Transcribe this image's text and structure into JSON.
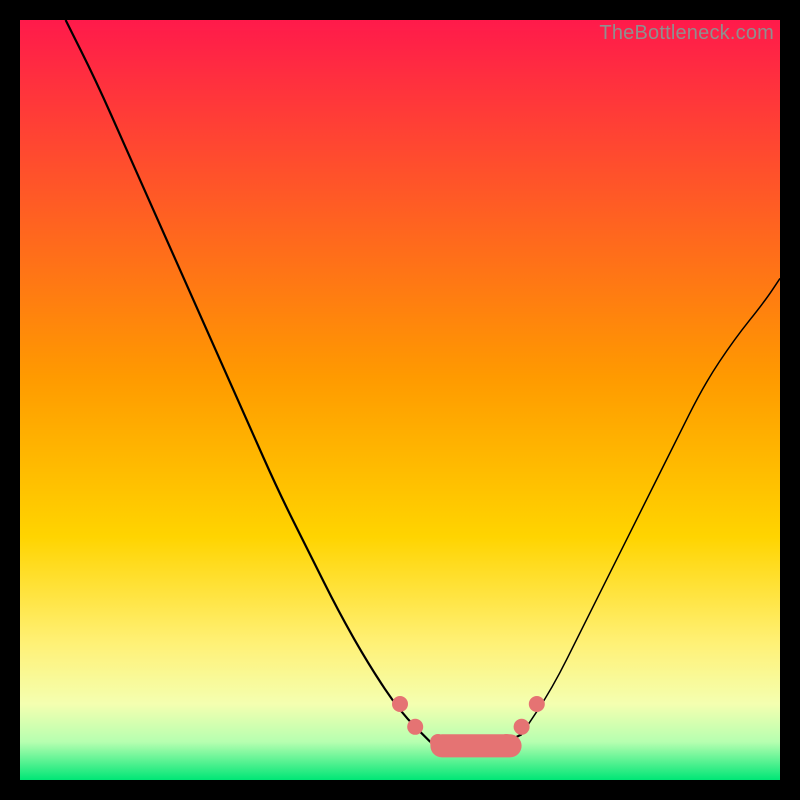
{
  "watermark": "TheBottleneck.com",
  "chart_data": {
    "type": "line",
    "title": "",
    "xlabel": "",
    "ylabel": "",
    "xlim": [
      0,
      100
    ],
    "ylim": [
      0,
      100
    ],
    "grid": false,
    "legend": false,
    "background_gradient": {
      "top_color": "#ff1a4b",
      "mid_color": "#ffd400",
      "bottom_color": "#00e676",
      "stops": [
        {
          "pos": 0.0,
          "color": "#ff1a4b"
        },
        {
          "pos": 0.47,
          "color": "#ff9a00"
        },
        {
          "pos": 0.68,
          "color": "#ffd400"
        },
        {
          "pos": 0.82,
          "color": "#fff176"
        },
        {
          "pos": 0.9,
          "color": "#f4ffb0"
        },
        {
          "pos": 0.95,
          "color": "#b6ffb0"
        },
        {
          "pos": 1.0,
          "color": "#00e676"
        }
      ]
    },
    "series": [
      {
        "name": "left-curve",
        "stroke": "#000000",
        "x": [
          6,
          10,
          14,
          18,
          22,
          26,
          30,
          34,
          38,
          42,
          46,
          50,
          54
        ],
        "y": [
          100,
          92,
          83,
          74,
          65,
          56,
          47,
          38,
          30,
          22,
          15,
          9,
          5
        ]
      },
      {
        "name": "valley-floor",
        "stroke": "#000000",
        "x": [
          54,
          56,
          58,
          60,
          62,
          64,
          66
        ],
        "y": [
          5,
          4.6,
          4.5,
          4.5,
          4.6,
          5,
          6
        ]
      },
      {
        "name": "right-curve",
        "stroke": "#000000",
        "x": [
          66,
          70,
          74,
          78,
          82,
          86,
          90,
          94,
          98,
          100
        ],
        "y": [
          6,
          12,
          20,
          28,
          36,
          44,
          52,
          58,
          63,
          66
        ]
      },
      {
        "name": "valley-markers",
        "type": "scatter",
        "stroke": "#e57373",
        "fill": "#e57373",
        "x": [
          50,
          52,
          55,
          58,
          61,
          64,
          66,
          68
        ],
        "y": [
          10,
          7,
          5,
          4.5,
          4.5,
          5,
          7,
          10
        ]
      },
      {
        "name": "valley-bar",
        "type": "bar",
        "stroke": "#e57373",
        "fill": "#e57373",
        "x_range": [
          54,
          66
        ],
        "y": 4.5,
        "thickness": 2
      }
    ]
  }
}
